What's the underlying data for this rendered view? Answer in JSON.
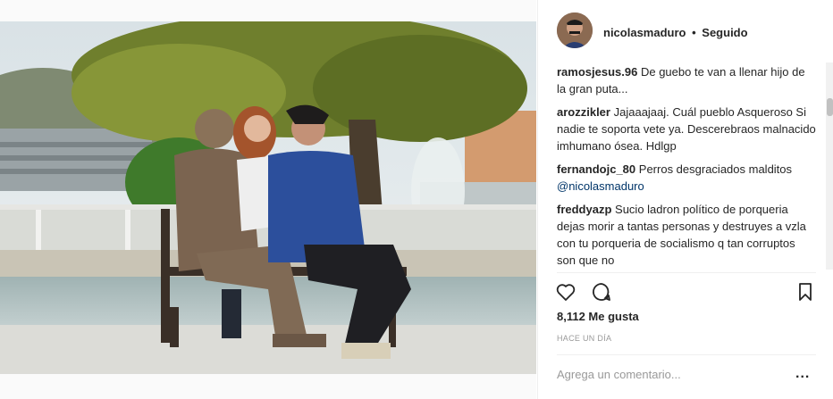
{
  "post": {
    "username": "nicolasmaduro",
    "separator": "•",
    "follow_status": "Seguido",
    "likes": "8,112 Me gusta",
    "timestamp": "HACE UN DÍA",
    "comment_placeholder": "Agrega un comentario...",
    "more_options": "..."
  },
  "comments": [
    {
      "user": "ramosjesus.96",
      "text": "De guebo te van a llenar hijo de la gran puta..."
    },
    {
      "user": "arozzikler",
      "text": "Jajaaajaaj. Cuál pueblo Asqueroso Si nadie te soporta vete ya. Descerebraos malnacido imhumano ósea. Hdlgp"
    },
    {
      "user": "fernandojc_80",
      "text": "Perros desgraciados malditos",
      "mention": "@nicolasmaduro"
    },
    {
      "user": "freddyazp",
      "text": "Sucio ladron político de porqueria dejas morir a tantas personas y destruyes a vzla con tu porqueria de socialismo q tan corruptos son que no"
    }
  ],
  "icons": [
    "heart-icon",
    "comment-icon",
    "bookmark-icon",
    "more-options-icon"
  ],
  "colors": {
    "link": "#003569",
    "muted": "#999999",
    "text": "#262626"
  }
}
